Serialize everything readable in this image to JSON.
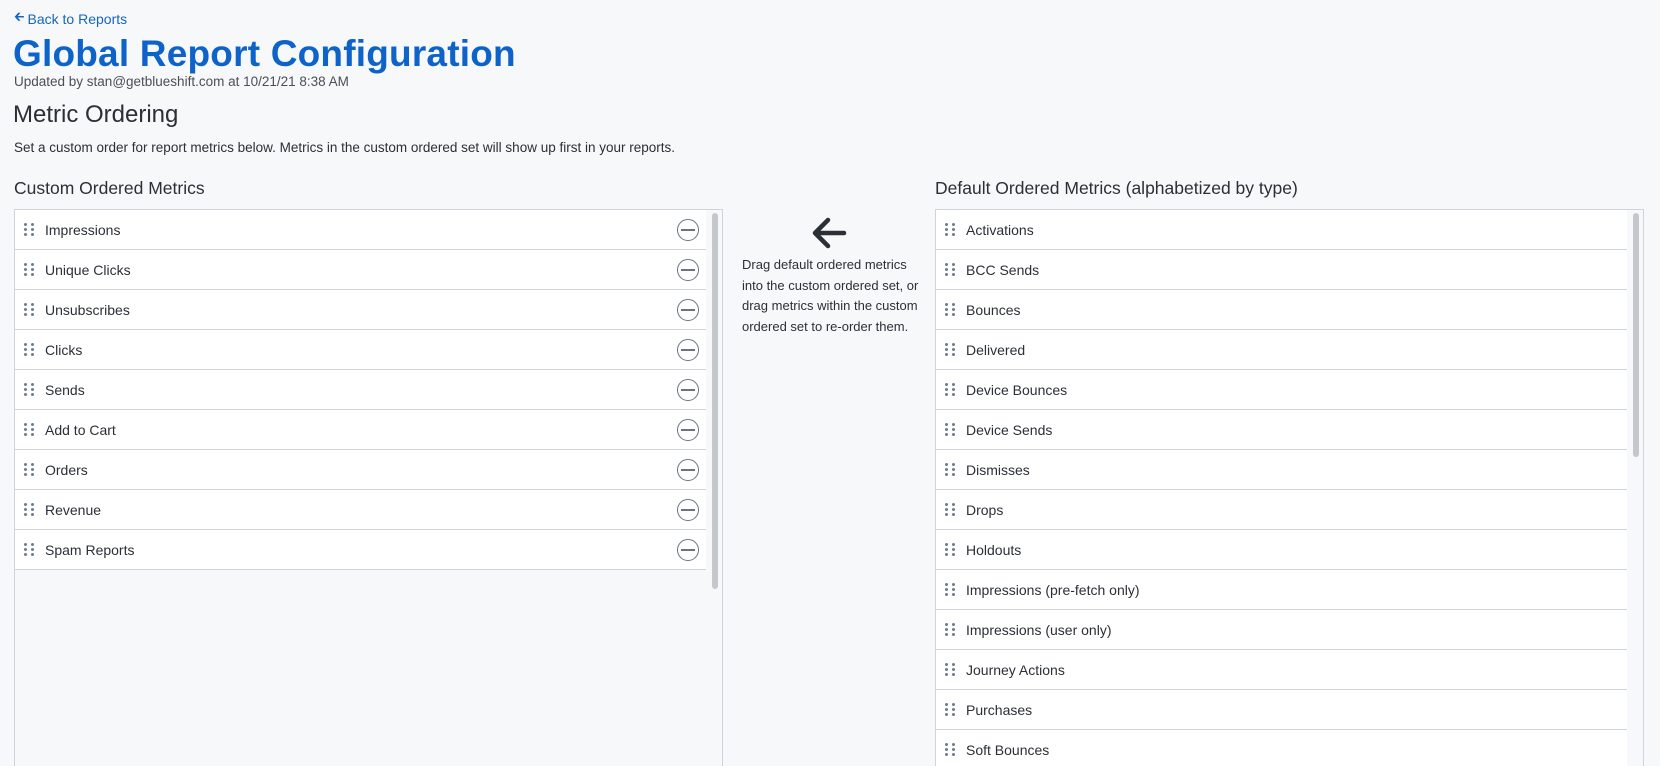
{
  "nav": {
    "back_label": "Back to Reports"
  },
  "header": {
    "title": "Global Report Configuration",
    "updated": "Updated by stan@getblueshift.com at 10/21/21 8:38 AM"
  },
  "section": {
    "title": "Metric Ordering",
    "description": "Set a custom order for report metrics below. Metrics in the custom ordered set will show up first in your reports."
  },
  "custom": {
    "title": "Custom Ordered Metrics",
    "items": [
      "Impressions",
      "Unique Clicks",
      "Unsubscribes",
      "Clicks",
      "Sends",
      "Add to Cart",
      "Orders",
      "Revenue",
      "Spam Reports"
    ]
  },
  "instructions": {
    "icon": "left-arrow-icon",
    "text": "Drag default ordered metrics into the custom ordered set, or drag metrics within the custom ordered set to re-order them."
  },
  "default": {
    "title": "Default Ordered Metrics (alphabetized by type)",
    "items": [
      "Activations",
      "BCC Sends",
      "Bounces",
      "Delivered",
      "Device Bounces",
      "Device Sends",
      "Dismisses",
      "Drops",
      "Holdouts",
      "Impressions (pre-fetch only)",
      "Impressions (user only)",
      "Journey Actions",
      "Purchases",
      "Soft Bounces"
    ]
  },
  "colors": {
    "accent": "#0e63c9",
    "link": "#1565c0",
    "background": "#f7f8fa",
    "border": "#cfd4da"
  }
}
